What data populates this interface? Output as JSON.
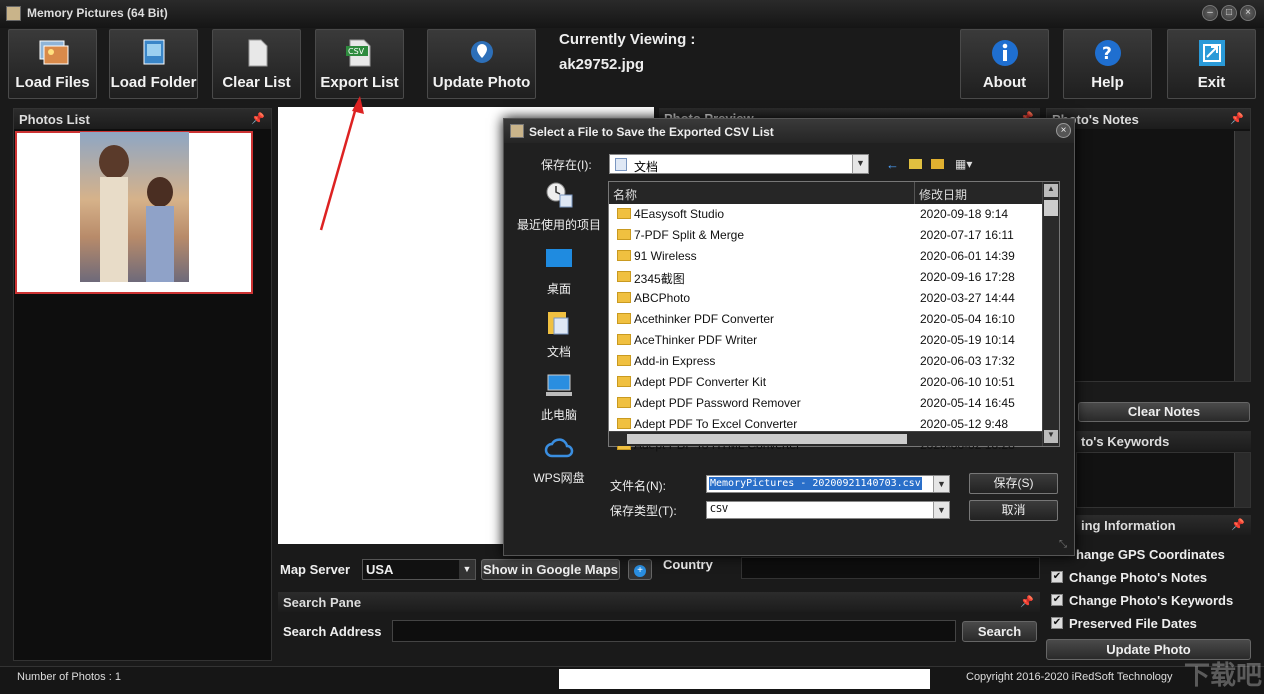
{
  "window": {
    "title": "Memory Pictures  (64 Bit)"
  },
  "toolbar": {
    "load_files": "Load Files",
    "load_folder": "Load Folder",
    "clear_list": "Clear List",
    "export_list": "Export List",
    "update_photo": "Update Photo",
    "about": "About",
    "help": "Help",
    "exit": "Exit"
  },
  "viewing": {
    "label": "Currently Viewing :",
    "file": "ak29752.jpg"
  },
  "panels": {
    "photos_list": "Photos List",
    "photo_preview": "Photo Preview",
    "photo_notes": "Photo's Notes",
    "clear_notes": "Clear Notes",
    "photo_keywords": "to's Keywords",
    "writing_info": "ing Information"
  },
  "options": [
    {
      "label": "hange GPS Coordinates",
      "checked": false
    },
    {
      "label": "Change Photo's Notes",
      "checked": true
    },
    {
      "label": "Change Photo's Keywords",
      "checked": true
    },
    {
      "label": "Preserved File Dates",
      "checked": true
    }
  ],
  "update_photo_btn": "Update Photo",
  "map": {
    "server_label": "Map Server",
    "server_value": "USA",
    "google_btn": "Show in Google Maps",
    "country_label": "Country"
  },
  "search": {
    "pane_title": "Search Pane",
    "address_label": "Search Address",
    "button": "Search"
  },
  "status": {
    "count": "Number of Photos : 1",
    "copyright": "Copyright 2016-2020 iRedSoft Technology"
  },
  "watermark": "下载吧",
  "dialog": {
    "title": "Select a File to Save the Exported CSV List",
    "save_in_label": "保存在(I):",
    "save_in_value": "文档",
    "places": [
      "最近使用的项目",
      "桌面",
      "文档",
      "此电脑",
      "WPS网盘"
    ],
    "columns": {
      "name": "名称",
      "date": "修改日期"
    },
    "files": [
      {
        "name": "4Easysoft Studio",
        "date": "2020-09-18 9:14"
      },
      {
        "name": "7-PDF Split & Merge",
        "date": "2020-07-17 16:11"
      },
      {
        "name": "91 Wireless",
        "date": "2020-06-01 14:39"
      },
      {
        "name": "2345截图",
        "date": "2020-09-16 17:28"
      },
      {
        "name": "ABCPhoto",
        "date": "2020-03-27 14:44"
      },
      {
        "name": "Acethinker PDF Converter",
        "date": "2020-05-04 16:10"
      },
      {
        "name": "AceThinker PDF Writer",
        "date": "2020-05-19 10:14"
      },
      {
        "name": "Add-in Express",
        "date": "2020-06-03 17:32"
      },
      {
        "name": "Adept PDF Converter Kit",
        "date": "2020-06-10 10:51"
      },
      {
        "name": "Adept PDF Password Remover",
        "date": "2020-05-14 16:45"
      },
      {
        "name": "Adept PDF To Excel Converter",
        "date": "2020-05-12 9:48"
      },
      {
        "name": "Adept PDF To HTML Converter",
        "date": "2020-06-02 16:28"
      }
    ],
    "filename_label": "文件名(N):",
    "filename_value": "MemoryPictures - 20200921140703.csv",
    "filetype_label": "保存类型(T):",
    "filetype_value": "CSV",
    "save_btn": "保存(S)",
    "cancel_btn": "取消"
  }
}
